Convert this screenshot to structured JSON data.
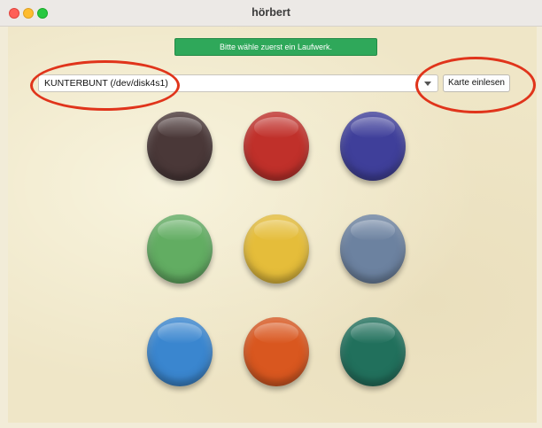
{
  "window": {
    "title": "hörbert"
  },
  "status_banner": "Bitte wähle zuerst ein Laufwerk.",
  "drive_select": {
    "value": "KUNTERBUNT (/dev/disk4s1)"
  },
  "read_card_button": "Karte einlesen",
  "colors": {
    "banner": "#2fa85a",
    "annotation": "#e0341b",
    "background": "#efe6c7"
  },
  "discs": [
    {
      "name": "disc-dark-brown",
      "color": "#4a3838"
    },
    {
      "name": "disc-red",
      "color": "#c0302a"
    },
    {
      "name": "disc-indigo",
      "color": "#3f3f9a"
    },
    {
      "name": "disc-green",
      "color": "#62ad62"
    },
    {
      "name": "disc-yellow",
      "color": "#e5bd3a"
    },
    {
      "name": "disc-slate-blue",
      "color": "#6c82a0"
    },
    {
      "name": "disc-blue",
      "color": "#3a86cf"
    },
    {
      "name": "disc-orange",
      "color": "#d9571f"
    },
    {
      "name": "disc-teal",
      "color": "#21705c"
    }
  ]
}
